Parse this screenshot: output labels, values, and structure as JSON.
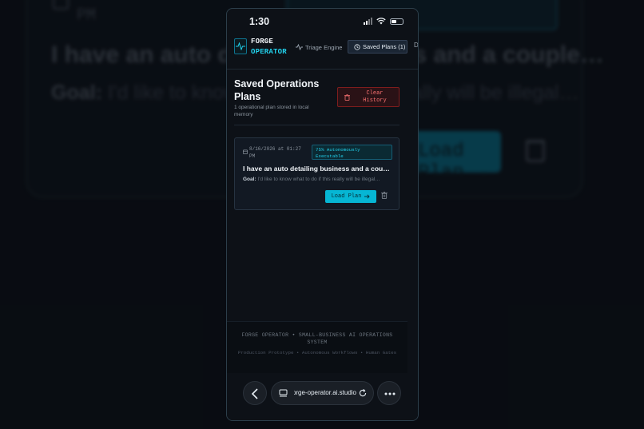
{
  "background": {
    "date_suffix": "PM",
    "title": "I have an auto detailing business and a couple…",
    "goal_label": "Goal:",
    "goal_text": " I'd like to know what to do if this really will be illegal…",
    "load_label": "Load Plan"
  },
  "status_bar": {
    "time": "1:30"
  },
  "app": {
    "brand_line1": "FORGE",
    "brand_line2": "OPERATOR",
    "nav": {
      "triage": "Triage Engine",
      "saved": "Saved Plans (1)",
      "more": "D"
    },
    "accent_color": "#22d3ee"
  },
  "saved_section": {
    "title": "Saved Operations Plans",
    "subtitle": "1 operational plan stored in local memory",
    "clear_button": "Clear History"
  },
  "plans": [
    {
      "date": "8/16/2026 at 01:27 PM",
      "badge": "75% Autonomously Executable",
      "title": "I have an auto detailing business and a couple of employees…",
      "goal_label": "Goal:",
      "goal_text": " I'd like to know what to do if this really will be illegal…",
      "load_button": "Load Plan"
    }
  ],
  "footer": {
    "line1": "FORGE OPERATOR • SMALL-BUSINESS AI OPERATIONS SYSTEM",
    "line2": "Production Prototype • Autonomous Workflows • Human Gates"
  },
  "browser": {
    "url": "forge-operator.ai.studio"
  }
}
